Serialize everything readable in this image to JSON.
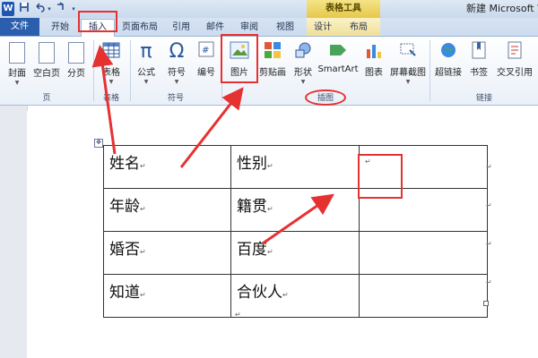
{
  "quick_access": {
    "app_logo": "W",
    "save_icon": "save-icon",
    "undo_icon": "undo-icon",
    "redo_icon": "redo-icon"
  },
  "context_title": "表格工具",
  "window_title": "新建 Microsoft Word",
  "tabs": [
    {
      "label": "文件"
    },
    {
      "label": "开始"
    },
    {
      "label": "插入"
    },
    {
      "label": "页面布局"
    },
    {
      "label": "引用"
    },
    {
      "label": "邮件"
    },
    {
      "label": "审阅"
    },
    {
      "label": "视图"
    },
    {
      "label": "设计"
    },
    {
      "label": "布局"
    }
  ],
  "ribbon": {
    "pages": {
      "cover": "封面",
      "blank": "空白页",
      "break": "分页",
      "group": "页"
    },
    "table": {
      "table": "表格",
      "group": "表格"
    },
    "symbols": {
      "formula": "公式",
      "symbol": "符号",
      "number": "编号",
      "group": "符号"
    },
    "illustrations": {
      "picture": "图片",
      "clipart": "剪贴画",
      "shapes": "形状",
      "smartart": "SmartArt",
      "chart": "图表",
      "screenshot": "屏幕截图",
      "group": "插图"
    },
    "links": {
      "hyperlink": "超链接",
      "bookmark": "书签",
      "crossref": "交叉引用",
      "group": "链接"
    }
  },
  "table_rows": [
    [
      "姓名",
      "性别",
      ""
    ],
    [
      "年龄",
      "籍贯",
      ""
    ],
    [
      "婚否",
      "百度",
      ""
    ],
    [
      "知道",
      "合伙人",
      ""
    ]
  ],
  "colors": {
    "accent": "#2b5fad",
    "annotation_red": "#e63131",
    "context_tab": "#e6c84a"
  }
}
